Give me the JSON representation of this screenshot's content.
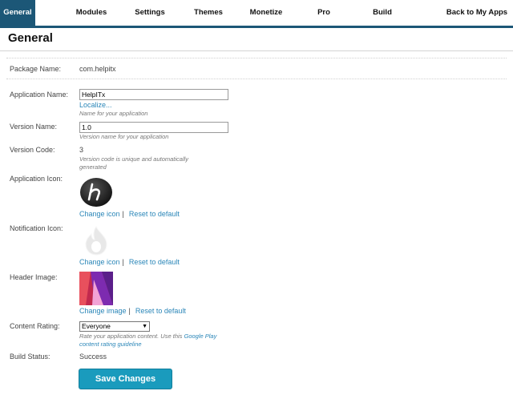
{
  "nav": {
    "tabs": [
      {
        "label": "General",
        "active": true
      },
      {
        "label": "Modules"
      },
      {
        "label": "Settings"
      },
      {
        "label": "Themes"
      },
      {
        "label": "Monetize"
      },
      {
        "label": "Pro"
      },
      {
        "label": "Build"
      },
      {
        "label": "Back to My Apps"
      }
    ]
  },
  "page_title": "General",
  "package": {
    "label": "Package Name:",
    "value": "com.helpitx"
  },
  "app_name": {
    "label": "Application Name:",
    "value": "HelpITx",
    "localize": "Localize...",
    "hint": "Name for your application"
  },
  "version_name": {
    "label": "Version Name:",
    "value": "1.0",
    "hint": "Version name for your application"
  },
  "version_code": {
    "label": "Version Code:",
    "value": "3",
    "hint": "Version code is unique and automatically generated"
  },
  "app_icon": {
    "label": "Application Icon:",
    "change": "Change icon",
    "separator": "|",
    "reset": "Reset to default",
    "icon": "h-letter-icon"
  },
  "notif_icon": {
    "label": "Notification Icon:",
    "change": "Change icon",
    "separator": "|",
    "reset": "Reset to default",
    "icon": "flame-icon"
  },
  "header_image": {
    "label": "Header Image:",
    "change": "Change image",
    "separator": "|",
    "reset": "Reset to default"
  },
  "content_rating": {
    "label": "Content Rating:",
    "selected": "Everyone",
    "hint_prefix": "Rate your application content. Use this",
    "hint_link": "Google Play content rating guideline"
  },
  "build_status": {
    "label": "Build Status:",
    "value": "Success"
  },
  "save_label": "Save Changes",
  "colors": {
    "nav_accent": "#1c5777",
    "link": "#2a86b8",
    "button": "#1a9bbd"
  }
}
